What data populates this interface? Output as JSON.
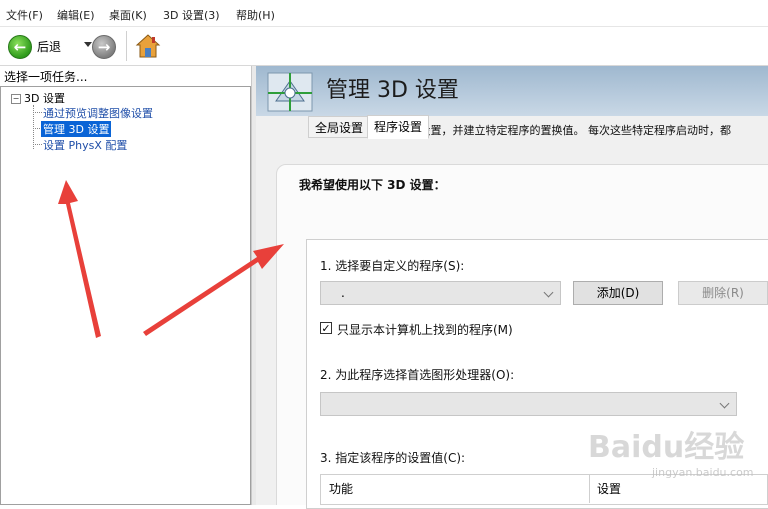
{
  "menu": {
    "items": [
      "文件(F)",
      "编辑(E)",
      "桌面(K)",
      "3D 设置(3)",
      "帮助(H)"
    ]
  },
  "toolbar": {
    "back_label": "后退",
    "icons": [
      "back-arrow-icon",
      "forward-arrow-icon",
      "home-icon"
    ]
  },
  "left": {
    "title": "选择一项任务...",
    "tree": {
      "root": "3D 设置",
      "children": [
        "通过预览调整图像设置",
        "管理 3D 设置",
        "设置 PhysX 配置"
      ],
      "selected_index": 1
    }
  },
  "main": {
    "banner_title": "管理 3D 设置",
    "description": "您可以更改全局 3D 设置，并建立特定程序的置换值。 每次这些特定程序启动时，都",
    "panel_title": "我希望使用以下 3D 设置：",
    "tabs": [
      "全局设置",
      "程序设置"
    ],
    "active_tab": 1,
    "section1_label": "1. 选择要自定义的程序(S):",
    "program_value": ".",
    "add_button": "添加(D)",
    "delete_button": "删除(R)",
    "checkbox_label": "只显示本计算机上找到的程序(M)",
    "checkbox_checked": true,
    "section2_label": "2. 为此程序选择首选图形处理器(O):",
    "gpu_value": "",
    "section3_label": "3. 指定该程序的设置值(C):",
    "table_headers": [
      "功能",
      "设置"
    ]
  },
  "watermark": {
    "text": "Baidu经验",
    "sub": "jingyan.baidu.com"
  },
  "colors": {
    "selection": "#0a64d6",
    "link": "#1f4ea8",
    "arrow": "#e8403a",
    "banner": "#9fb8cf"
  }
}
